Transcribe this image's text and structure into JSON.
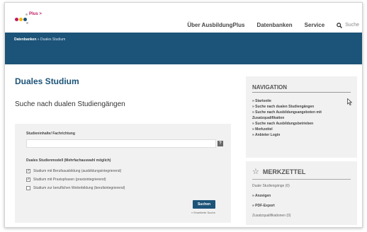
{
  "header": {
    "logo_text": "Plus >",
    "nav": [
      "Über AusbildungPlus",
      "Datenbanken",
      "Service"
    ],
    "search_label": "Suche"
  },
  "breadcrumb": {
    "parent": "Datenbanken",
    "separator": " » ",
    "current": "Duales Studium"
  },
  "main": {
    "title": "Duales Studium",
    "subtitle": "Suche nach dualen Studiengängen",
    "form": {
      "field_label": "Studieninhalte/ Fachrichtung",
      "field_value": "",
      "help_label": "?",
      "model_label": "Duales Studienmodell (Mehrfachauswahl möglich)",
      "options": [
        {
          "label": "Studium mit Berufsausbildung (ausbildungsintegrierend)",
          "checked": true,
          "mark": "✓"
        },
        {
          "label": "Studium mit Praxisphasen (praxisintegrierend)",
          "checked": true,
          "mark": "✓"
        },
        {
          "label": "Studium zur beruflichen Weiterbildung (berufsintegrierend)",
          "checked": false,
          "mark": ""
        }
      ],
      "submit_label": "Suchen",
      "advanced_link": "» Erweiterte Suche"
    }
  },
  "sidebar": {
    "nav_title": "NAVIGATION",
    "nav_items": [
      "» Startseite",
      "» Suche nach dualen Studiengängen",
      "» Suche nach Ausbildungsangeboten mit Zusatzqualifikation",
      "» Suche nach Ausbildungsbetrieben",
      "» Merkzettel",
      "» Anbieter Login"
    ],
    "merk_title": "MERKZETTEL",
    "merk_items": {
      "dual": "Duale Studiengänge (0)",
      "show": "» Anzeigen",
      "pdf": "» PDF-Export",
      "zusatz": "Zusatzqualifikationen (0)"
    }
  },
  "colors": {
    "brand_blue": "#1c5378",
    "panel_grey": "#f1f1f1",
    "logo_magenta": "#c0185f"
  }
}
